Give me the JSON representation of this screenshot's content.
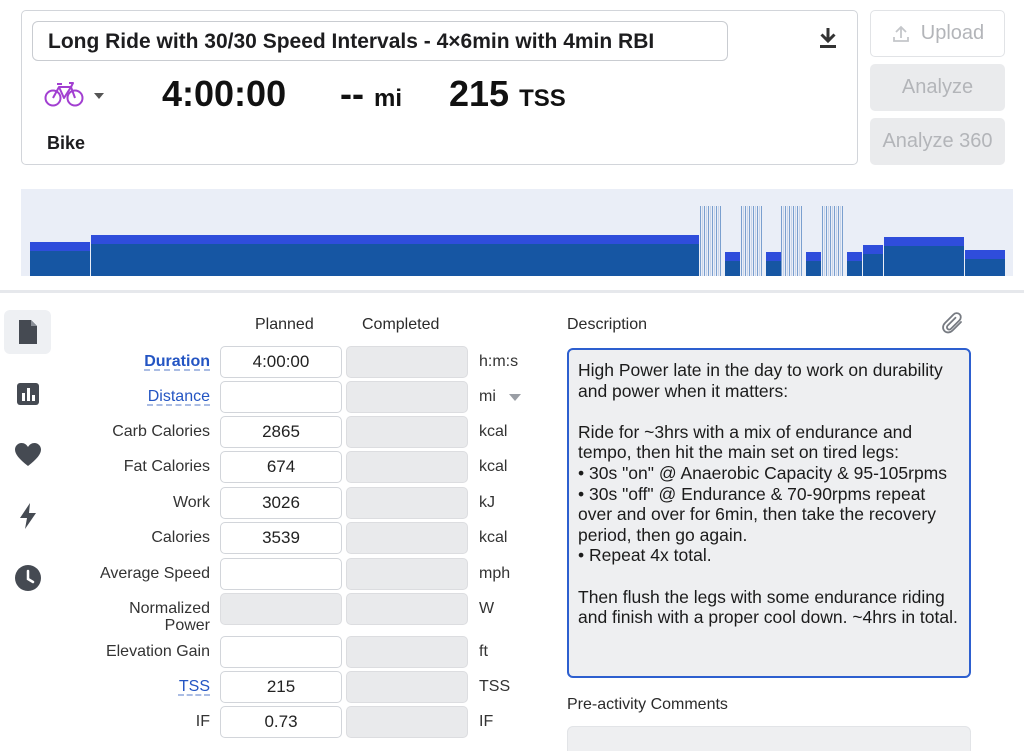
{
  "header": {
    "title": "Long Ride with 30/30 Speed Intervals - 4×6min with 4min RBI",
    "duration": "4:00:00",
    "distance_value": "--",
    "distance_unit": "mi",
    "tss_value": "215",
    "tss_unit": "TSS",
    "sport": "Bike"
  },
  "buttons": {
    "upload": "Upload",
    "analyze": "Analyze",
    "analyze360": "Analyze 360"
  },
  "workout_graph": {
    "colors": {
      "dark": "#1656a3",
      "light": "#2f4ddb",
      "edge": "#ffffff"
    }
  },
  "columns": {
    "planned": "Planned",
    "completed": "Completed"
  },
  "rows": [
    {
      "label": "Duration",
      "planned": "4:00:00",
      "unit": "h:m:s"
    },
    {
      "label": "Distance",
      "planned": "",
      "unit": "mi"
    },
    {
      "label": "Carb Calories",
      "planned": "2865",
      "unit": "kcal"
    },
    {
      "label": "Fat Calories",
      "planned": "674",
      "unit": "kcal"
    },
    {
      "label": "Work",
      "planned": "3026",
      "unit": "kJ"
    },
    {
      "label": "Calories",
      "planned": "3539",
      "unit": "kcal"
    },
    {
      "label": "Average Speed",
      "planned": "",
      "unit": "mph"
    },
    {
      "label": "Normalized\nPower",
      "planned": "",
      "unit": "W"
    },
    {
      "label": "Elevation Gain",
      "planned": "",
      "unit": "ft"
    },
    {
      "label": "TSS",
      "planned": "215",
      "unit": "TSS"
    },
    {
      "label": "IF",
      "planned": "0.73",
      "unit": "IF"
    }
  ],
  "description": {
    "label": "Description",
    "text": "High Power late in the day to work on durability and power when it matters:\n\nRide for ~3hrs with a mix of endurance and tempo, then hit the main set on tired legs:\n• 30s \"on\" @ Anaerobic Capacity & 95-105rpms\n• 30s \"off\" @ Endurance & 70-90rpms repeat over and over for 6min, then take the recovery period, then go again.\n• Repeat 4x total.\n\nThen flush the legs with some endurance riding and finish with a proper cool down. ~4hrs in total."
  },
  "pre_activity": {
    "label": "Pre-activity Comments",
    "value": ""
  },
  "colors": {
    "accent": "#2455c3",
    "bike": "#a23fd1"
  }
}
